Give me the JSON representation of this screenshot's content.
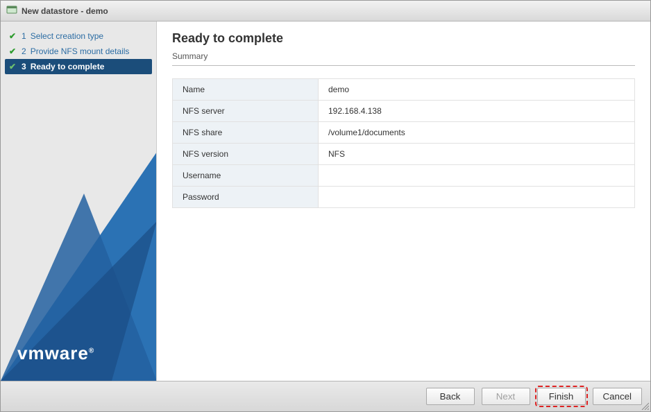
{
  "window": {
    "title": "New datastore - demo"
  },
  "sidebar": {
    "steps": [
      {
        "num": "1",
        "label": "Select creation type"
      },
      {
        "num": "2",
        "label": "Provide NFS mount details"
      },
      {
        "num": "3",
        "label": "Ready to complete"
      }
    ],
    "logo_text": "vmware"
  },
  "main": {
    "heading": "Ready to complete",
    "subtitle": "Summary",
    "rows": [
      {
        "label": "Name",
        "value": "demo"
      },
      {
        "label": "NFS server",
        "value": "192.168.4.138"
      },
      {
        "label": "NFS share",
        "value": "/volume1/documents"
      },
      {
        "label": "NFS version",
        "value": "NFS"
      },
      {
        "label": "Username",
        "value": ""
      },
      {
        "label": "Password",
        "value": ""
      }
    ]
  },
  "footer": {
    "back": "Back",
    "next": "Next",
    "finish": "Finish",
    "cancel": "Cancel"
  }
}
